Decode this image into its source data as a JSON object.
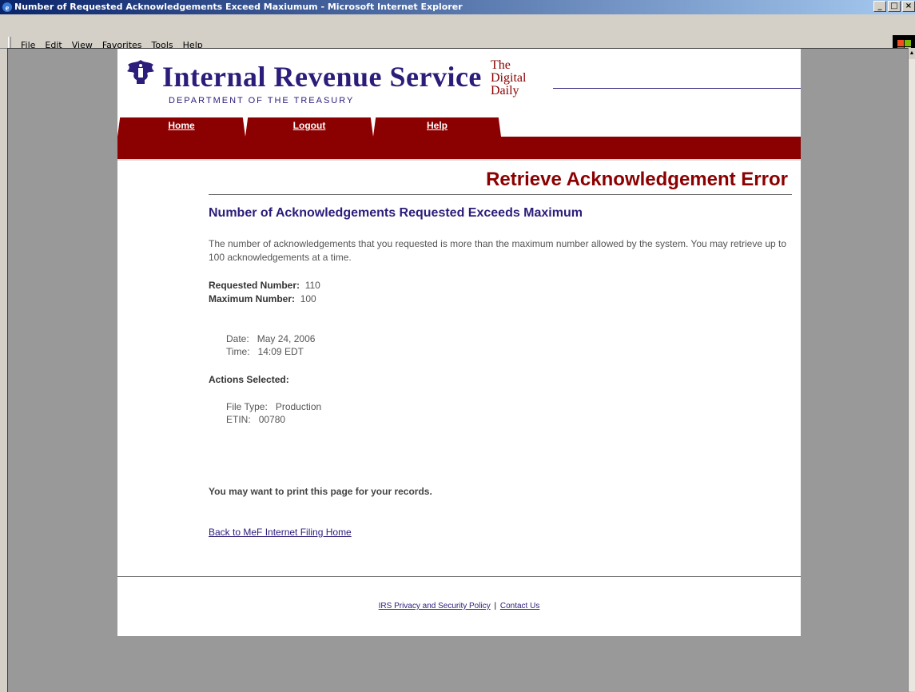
{
  "window": {
    "title": "Number of Requested Acknowledgements Exceed Maxiumum - Microsoft Internet Explorer",
    "buttons": [
      "_",
      "□",
      "×"
    ]
  },
  "menu": {
    "items": [
      "File",
      "Edit",
      "View",
      "Favorites",
      "Tools",
      "Help"
    ]
  },
  "header": {
    "agency": "Internal Revenue Service",
    "department": "DEPARTMENT OF THE TREASURY",
    "tagline": "The\nDigital\nDaily"
  },
  "nav": {
    "tabs": [
      "Home",
      "Logout",
      "Help"
    ]
  },
  "main": {
    "heading": "Retrieve Acknowledgement Error",
    "subheading": "Number of Acknowledgements Requested Exceeds Maximum",
    "description": "The number of acknowledgements that you requested is more than the maximum number allowed by the system. You may retrieve up to 100 acknowledgements at a time.",
    "requested_label": "Requested Number:",
    "requested_value": "110",
    "maximum_label": "Maximum Number:",
    "maximum_value": "100",
    "date_label": "Date:",
    "date_value": "May 24, 2006",
    "time_label": "Time:",
    "time_value": "14:09 EDT",
    "actions_label": "Actions Selected:",
    "file_type_label": "File Type:",
    "file_type_value": "Production",
    "etin_label": "ETIN:",
    "etin_value": "00780",
    "print_note": "You may want to print this page for your records.",
    "back_link": "Back to MeF Internet Filing Home"
  },
  "footer": {
    "privacy_link": "IRS Privacy and Security Policy",
    "separator": "|",
    "contact_link": "Contact Us"
  },
  "colors": {
    "brand_blue": "#2b1d7a",
    "brand_red": "#8b0000",
    "chrome": "#d4d0c8",
    "viewport_bg": "#999999"
  }
}
